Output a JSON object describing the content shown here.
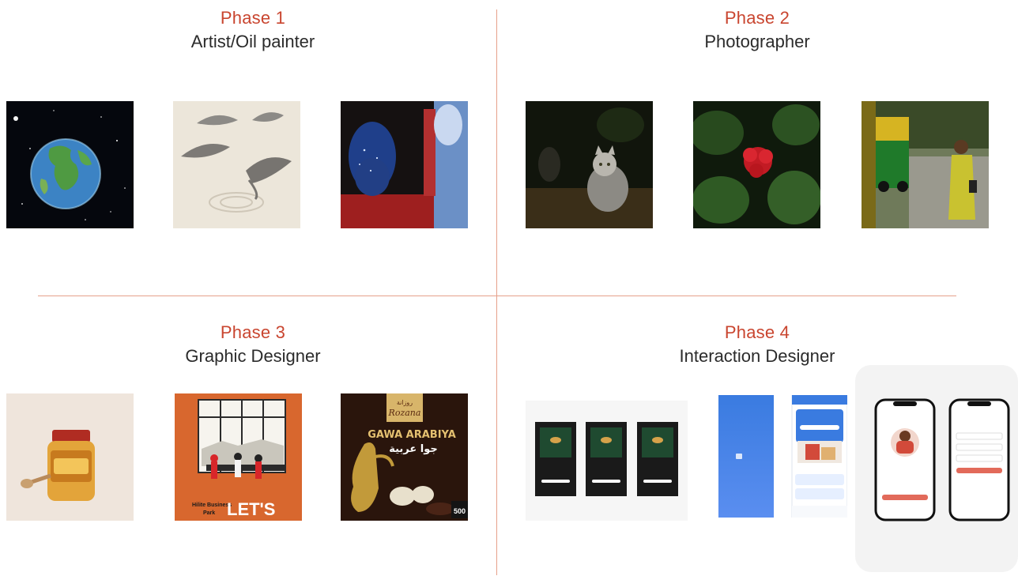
{
  "phases": [
    {
      "phase": "Phase 1",
      "role": "Artist/Oil painter"
    },
    {
      "phase": "Phase 2",
      "role": "Photographer"
    },
    {
      "phase": "Phase 3",
      "role": "Graphic Designer"
    },
    {
      "phase": "Phase 4",
      "role": "Interaction Designer"
    }
  ],
  "artwork_text": {
    "hilite_line1": "Hilite Business",
    "hilite_line2": "Park",
    "lets": "LET'S",
    "rozana_ar": "روزانة",
    "rozana": "Rozana",
    "gawa": "GAWA ARABIYA",
    "gawa_ar": "جوا عربية",
    "price": "500"
  },
  "colors": {
    "accent": "#c9452f",
    "divider": "#e6a08a"
  }
}
